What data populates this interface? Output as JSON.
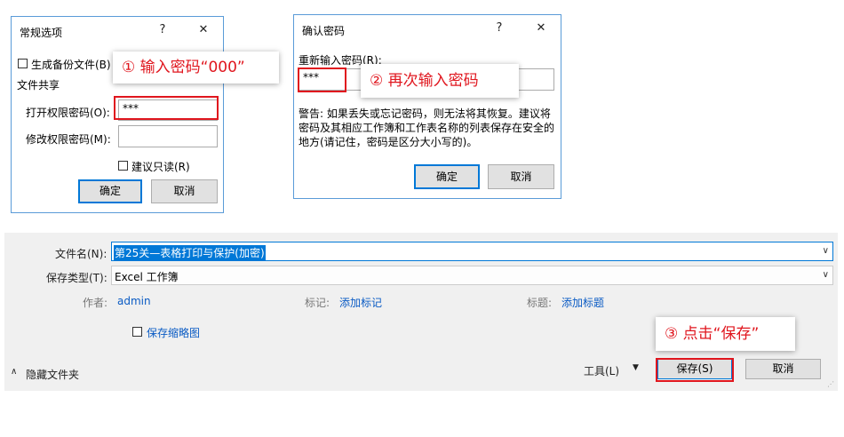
{
  "dialog1": {
    "title": "常规选项",
    "help": "?",
    "close": "✕",
    "backup_label": "生成备份文件(B)",
    "share_group": "文件共享",
    "open_pwd_label": "打开权限密码(O):",
    "open_pwd_value": "***",
    "modify_pwd_label": "修改权限密码(M):",
    "modify_pwd_value": "",
    "readonly_label": "建议只读(R)",
    "ok": "确定",
    "cancel": "取消"
  },
  "dialog2": {
    "title": "确认密码",
    "help": "?",
    "close": "✕",
    "reenter_label": "重新输入密码(R):",
    "pwd_value": "***",
    "warning": "警告: 如果丢失或忘记密码，则无法将其恢复。建议将密码及其相应工作簿和工作表名称的列表保存在安全的地方(请记住，密码是区分大小写的)。",
    "ok": "确定",
    "cancel": "取消"
  },
  "annotations": {
    "step1": "① 输入密码“000”",
    "step2": "② 再次输入密码",
    "step3": "③ 点击“保存”"
  },
  "save_dialog": {
    "filename_label": "文件名(N):",
    "filename_value": "第25关—表格打印与保护(加密)",
    "filetype_label": "保存类型(T):",
    "filetype_value": "Excel 工作簿",
    "author_label": "作者:",
    "author_value": "admin",
    "tags_label": "标记:",
    "tags_value": "添加标记",
    "title_label": "标题:",
    "title_value": "添加标题",
    "thumbnail_label": "保存缩略图",
    "hide_folders": "隐藏文件夹",
    "tools": "工具(L)",
    "save": "保存(S)",
    "cancel": "取消"
  }
}
